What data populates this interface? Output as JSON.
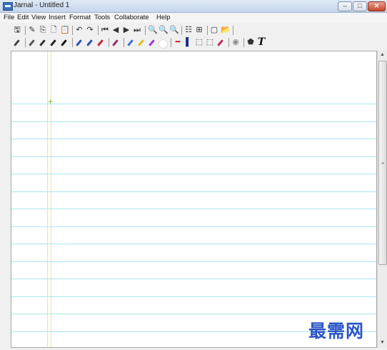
{
  "window": {
    "title": "Jarnal - Untitled 1",
    "min_label": "–",
    "max_label": "□",
    "close_label": "✕"
  },
  "menu": [
    "File",
    "Edit",
    "View",
    "Insert",
    "Format",
    "Tools",
    "Collaborate",
    "Help"
  ],
  "toolbar1": [
    {
      "name": "save-icon",
      "glyph": "🖫"
    },
    {
      "name": "sep"
    },
    {
      "name": "eraser-icon",
      "glyph": "✎"
    },
    {
      "name": "copy-icon",
      "glyph": "⎘"
    },
    {
      "name": "page-icon",
      "glyph": "🗋"
    },
    {
      "name": "paste-icon",
      "glyph": "📋"
    },
    {
      "name": "sep"
    },
    {
      "name": "undo-icon",
      "glyph": "↶"
    },
    {
      "name": "redo-icon",
      "glyph": "↷"
    },
    {
      "name": "sep"
    },
    {
      "name": "first-page-icon",
      "glyph": "⏮"
    },
    {
      "name": "prev-page-icon",
      "glyph": "◀"
    },
    {
      "name": "next-page-icon",
      "glyph": "▶"
    },
    {
      "name": "last-page-icon",
      "glyph": "⏭"
    },
    {
      "name": "sep"
    },
    {
      "name": "zoom-in-icon",
      "glyph": "🔍"
    },
    {
      "name": "zoom-out-icon",
      "glyph": "🔍"
    },
    {
      "name": "zoom-fit-icon",
      "glyph": "🔍"
    },
    {
      "name": "sep"
    },
    {
      "name": "layout-icon",
      "glyph": "☷"
    },
    {
      "name": "grid-icon",
      "glyph": "⊞"
    },
    {
      "name": "sep"
    },
    {
      "name": "new-page-icon",
      "glyph": "▢"
    },
    {
      "name": "open-icon",
      "glyph": "📂"
    },
    {
      "name": "sep"
    }
  ],
  "toolbar2": [
    {
      "name": "pen-icon",
      "color": "#444"
    },
    {
      "name": "sep"
    },
    {
      "name": "pencil-fine-icon",
      "color": "#555"
    },
    {
      "name": "pencil-medium-icon",
      "color": "#333"
    },
    {
      "name": "pencil-heavy-icon",
      "color": "#222"
    },
    {
      "name": "marker-icon",
      "color": "#111"
    },
    {
      "name": "sep"
    },
    {
      "name": "pen-blue-icon",
      "color": "#2a4fb8"
    },
    {
      "name": "pen-blue2-icon",
      "color": "#2a4fb8"
    },
    {
      "name": "pen-red-icon",
      "color": "#c0233a"
    },
    {
      "name": "sep"
    },
    {
      "name": "pen-special-icon",
      "color": "#9a2a6a"
    },
    {
      "name": "sep"
    },
    {
      "name": "highlighter-blue-icon",
      "color": "#3a6fd8"
    },
    {
      "name": "highlighter-yellow-icon",
      "color": "#d8c21a"
    },
    {
      "name": "highlighter-purple-icon",
      "color": "#9a3ad8"
    },
    {
      "name": "white-icon",
      "color": "#ffffff"
    },
    {
      "name": "sep"
    },
    {
      "name": "line-red-icon",
      "glyph": "━",
      "color": "#d01020"
    },
    {
      "name": "line-navy-icon",
      "glyph": "▌",
      "color": "#1b2a8a"
    },
    {
      "name": "select-icon",
      "glyph": "⬚"
    },
    {
      "name": "select-rect-icon",
      "glyph": "⬚"
    },
    {
      "name": "pen-tool-icon",
      "color": "#c02a5a"
    },
    {
      "name": "sep"
    },
    {
      "name": "color-icon",
      "glyph": "◉",
      "color": "#888"
    },
    {
      "name": "sep"
    },
    {
      "name": "shape-icon",
      "glyph": "⬟",
      "color": "#333"
    },
    {
      "name": "text-icon",
      "glyph": "T",
      "color": "#111"
    }
  ],
  "canvas": {
    "description": ""
  },
  "scrollbar": {
    "up": "▲",
    "down": "▼",
    "grip": "≡"
  },
  "watermark": "最需网",
  "colors": {
    "rule": "#a9e6ee",
    "margin": "#f2e48a",
    "watermark": "#2b56c7"
  }
}
